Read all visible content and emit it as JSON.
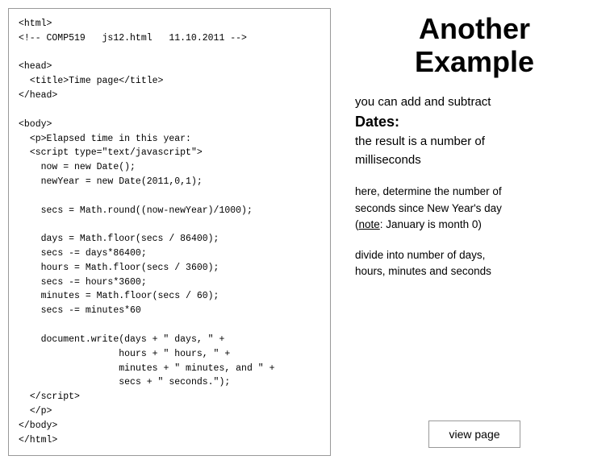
{
  "title": "Another\nExample",
  "left": {
    "code": "<html>\n<!-- COMP519   js12.html   11.10.2011 -->\n\n<head>\n  <title>Time page</title>\n</head>\n\n<body>\n  <p>Elapsed time in this year:\n  <script type=\"text/javascript\">\n    now = new Date();\n    newYear = new Date(2011,0,1);\n\n    secs = Math.round((now-newYear)/1000);\n\n    days = Math.floor(secs / 86400);\n    secs -= days*86400;\n    hours = Math.floor(secs / 3600);\n    secs -= hours*3600;\n    minutes = Math.floor(secs / 60);\n    secs -= minutes*60\n\n    document.write(days + \" days, \" +\n                  hours + \" hours, \" +\n                  minutes + \" minutes, and \" +\n                  secs + \" seconds.\");\n  <\\/script>\n  </p>\n</body>\n</html>"
  },
  "right": {
    "subtitle_line1": "you can add and subtract",
    "subtitle_dates": "Dates:",
    "subtitle_line2": "the result is a number of",
    "subtitle_line3": "milliseconds",
    "info_line1": "here, determine the number of",
    "info_line2": "seconds since New Year's day",
    "info_note": "note",
    "info_note_text": ":  January is month 0)",
    "info_paren_open": "(",
    "divide_line1": "divide into number of days,",
    "divide_line2": "hours, minutes and seconds",
    "view_btn": "view page"
  }
}
